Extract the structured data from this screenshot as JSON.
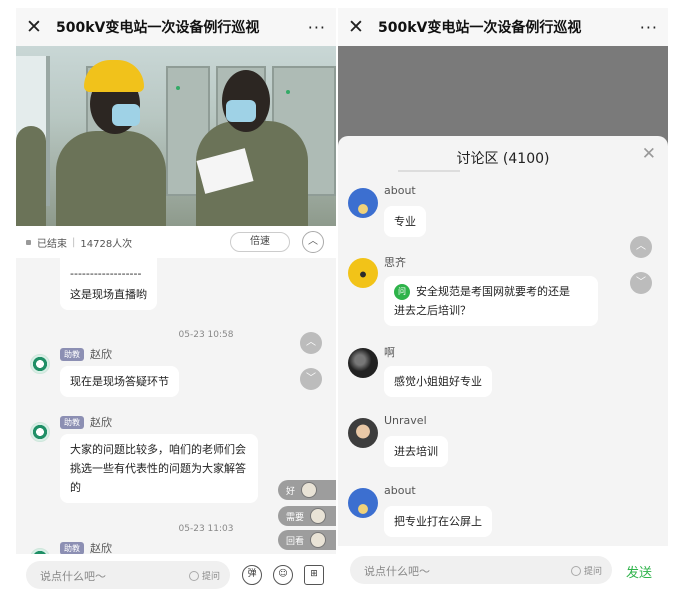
{
  "left": {
    "titlebar": {
      "close": "✕",
      "title": "500kV变电站一次设备例行巡视",
      "more": "···"
    },
    "videobar": {
      "status": "已结束",
      "viewers": "14728人次",
      "speed": "倍速",
      "collapse": "︿"
    },
    "chat": {
      "separator": "------------------",
      "msg0": "这是现场直播哟",
      "time1": "05-23 10:58",
      "tag": "助教",
      "name": "赵欣",
      "msg1": "现在是现场答疑环节",
      "msg2_l1": "大家的问题比较多，咱们的老师们会",
      "msg2_l2": "挑选一些有代表性的问题为大家解答",
      "msg2_l3": "的",
      "time2": "05-23 11:03"
    },
    "reactions": [
      "好",
      "需要",
      "回看"
    ],
    "input": {
      "placeholder": "说点什么吧～",
      "ask": "提问",
      "danmu": "弹",
      "emoji": "☺",
      "apps": "⊞"
    }
  },
  "right": {
    "titlebar": {
      "close": "✕",
      "title": "500kV变电站一次设备例行巡视",
      "more": "···"
    },
    "sheet": {
      "title": "讨论区 (4100)",
      "close": "✕"
    },
    "messages": [
      {
        "name": "about",
        "text": "专业"
      },
      {
        "name": "思齐",
        "badge": "问",
        "text_l1": "安全规范是考国网就要考的还是",
        "text_l2": "进去之后培训？"
      },
      {
        "name": "啊",
        "text": "感觉小姐姐好专业"
      },
      {
        "name": "Unravel",
        "text": "进去培训"
      },
      {
        "name": "about",
        "text": "把专业打在公屏上"
      }
    ],
    "input": {
      "placeholder": "说点什么吧～",
      "ask": "提问",
      "send": "发送"
    }
  }
}
